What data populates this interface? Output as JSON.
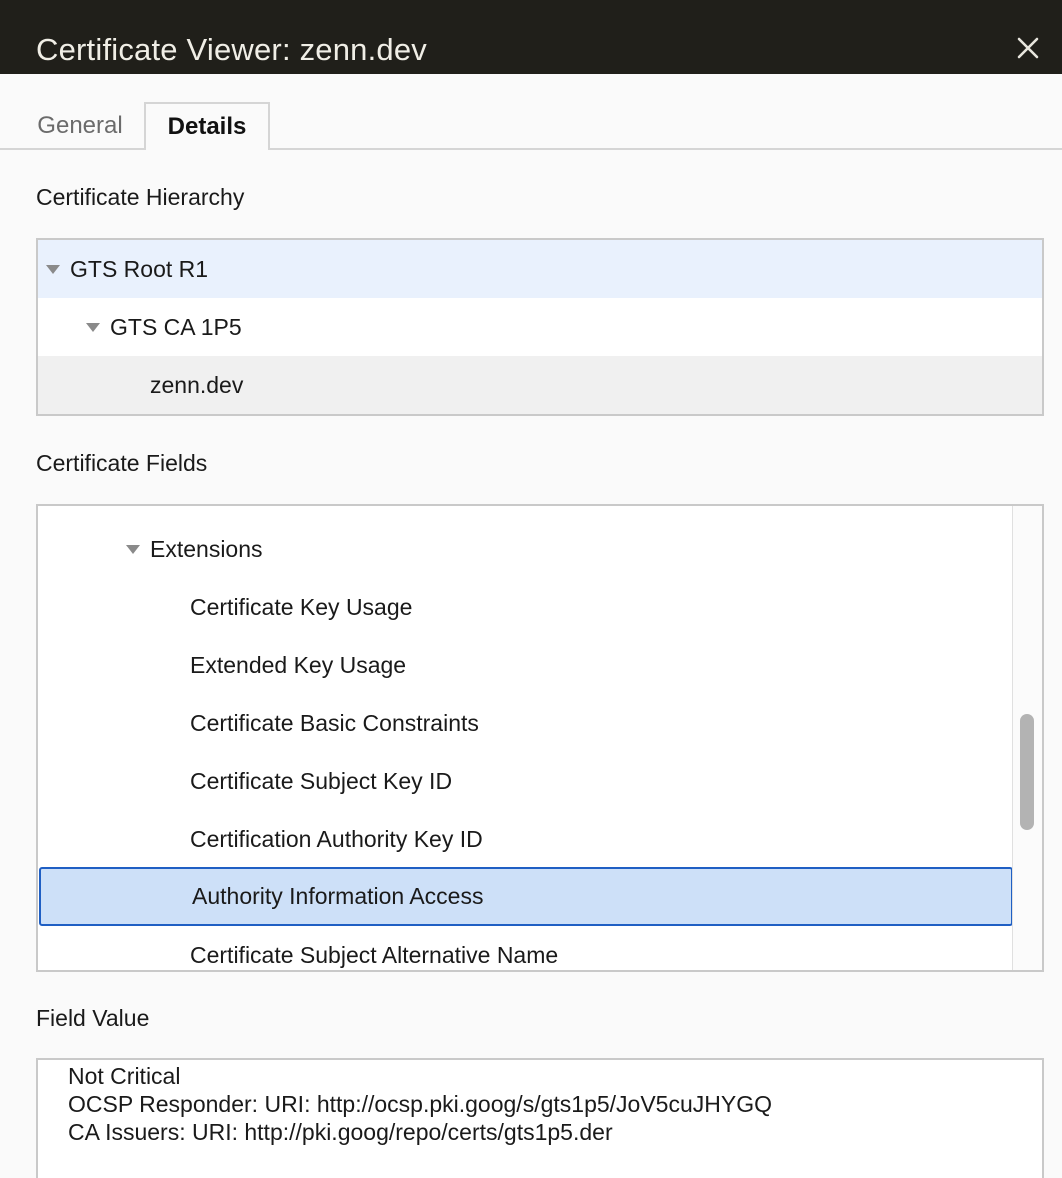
{
  "window": {
    "title": "Certificate Viewer: zenn.dev",
    "close_icon": "close-icon"
  },
  "tabs": [
    {
      "label": "General",
      "active": false
    },
    {
      "label": "Details",
      "active": true
    }
  ],
  "hierarchy": {
    "label": "Certificate Hierarchy",
    "items": [
      {
        "label": "GTS Root R1",
        "expanded": true
      },
      {
        "label": "GTS CA 1P5",
        "expanded": true
      },
      {
        "label": "zenn.dev",
        "selected": true
      }
    ]
  },
  "fields": {
    "label": "Certificate Fields",
    "items": [
      {
        "label": "Extensions",
        "expanded": true
      },
      {
        "label": "Certificate Key Usage"
      },
      {
        "label": "Extended Key Usage"
      },
      {
        "label": "Certificate Basic Constraints"
      },
      {
        "label": "Certificate Subject Key ID"
      },
      {
        "label": "Certification Authority Key ID"
      },
      {
        "label": "Authority Information Access",
        "selected": true
      },
      {
        "label": "Certificate Subject Alternative Name"
      }
    ]
  },
  "value": {
    "label": "Field Value",
    "lines": [
      "Not Critical",
      "OCSP Responder: URI: http://ocsp.pki.goog/s/gts1p5/JoV5cuJHYGQ",
      "CA Issuers: URI: http://pki.goog/repo/certs/gts1p5.der"
    ]
  },
  "colors": {
    "titlebar_bg": "#201f1a",
    "selection_bg": "#cde0f8",
    "selection_border": "#1f5fc4",
    "hover_bg": "#e9f1fd"
  }
}
